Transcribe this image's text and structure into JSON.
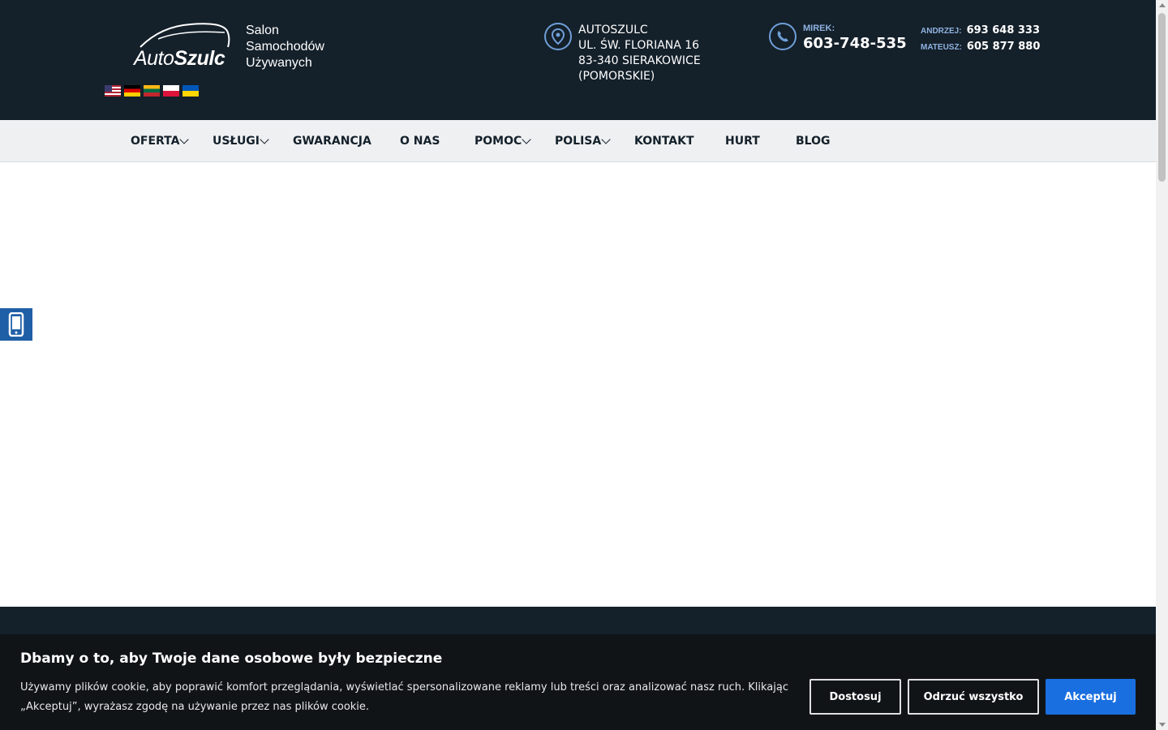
{
  "header": {
    "logo": {
      "text_regular": "Auto",
      "text_bold": "Szulc"
    },
    "tagline": [
      "Salon",
      "Samochodów",
      "Używanych"
    ],
    "flags": [
      "flag-us",
      "flag-de",
      "flag-lt",
      "flag-pl",
      "flag-ua"
    ],
    "address": {
      "icon": "location-pin-icon",
      "lines": [
        "AUTOSZULC",
        "UL. ŚW. FLORIANA 16",
        "83-340 SIERAKOWICE",
        "(POMORSKIE)"
      ]
    },
    "phone_main": {
      "icon": "phone-icon",
      "label": "MIREK:",
      "number": "603-748-535"
    },
    "phones": [
      {
        "label": "ANDRZEJ:",
        "number": "693 648 333"
      },
      {
        "label": "MATEUSZ:",
        "number": "605 877 880"
      }
    ]
  },
  "nav": {
    "items": [
      {
        "label": "OFERTA",
        "dropdown": true
      },
      {
        "label": "USŁUGI",
        "dropdown": true
      },
      {
        "label": "GWARANCJA",
        "dropdown": false
      },
      {
        "label": "O NAS",
        "dropdown": false
      },
      {
        "label": "POMOC",
        "dropdown": true
      },
      {
        "label": "POLISA",
        "dropdown": true
      },
      {
        "label": "KONTAKT",
        "dropdown": false
      },
      {
        "label": "HURT",
        "dropdown": false
      },
      {
        "label": "BLOG",
        "dropdown": false
      }
    ]
  },
  "side_tab": {
    "icon": "mobile-phone-icon"
  },
  "cookie": {
    "title": "Dbamy o to, aby Twoje dane osobowe były bezpieczne",
    "text": "Używamy plików cookie, aby poprawić komfort przeglądania, wyświetlać spersonalizowane reklamy lub treści oraz analizować nasz ruch. Klikając „Akceptuj”, wyrażasz zgodę na używanie przez nas plików cookie.",
    "customize_label": "Dostosuj",
    "reject_label": "Odrzuć wszystko",
    "accept_label": "Akceptuj"
  },
  "colors": {
    "header_bg": "#14202a",
    "nav_bg": "#eef0f2",
    "accent_blue": "#1a6fe0",
    "icon_blue": "#6f9fd8"
  }
}
